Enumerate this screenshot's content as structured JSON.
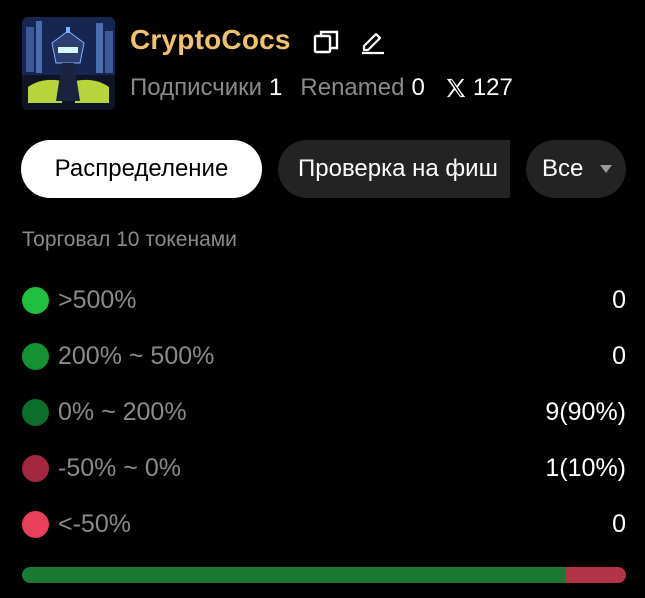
{
  "profile": {
    "name": "CryptoCocs",
    "followers_label": "Подписчики",
    "followers_value": "1",
    "renamed_label": "Renamed",
    "renamed_value": "0",
    "x_followers": "127"
  },
  "tabs": [
    {
      "label": "Распределение",
      "active": true
    },
    {
      "label": "Проверка на фиш",
      "active": false
    }
  ],
  "filter": {
    "selected": "Все"
  },
  "traded_text": "Торговал 10 токенами",
  "distribution": [
    {
      "label": ">500%",
      "value": "0",
      "color": "#1fbf3f"
    },
    {
      "label": "200% ~ 500%",
      "value": "0",
      "color": "#159334"
    },
    {
      "label": "0% ~ 200%",
      "value": "9(90%)",
      "color": "#0b6e2a"
    },
    {
      "label": "-50% ~ 0%",
      "value": "1(10%)",
      "color": "#a3283f"
    },
    {
      "label": "<-50%",
      "value": "0",
      "color": "#e8405a"
    }
  ],
  "bar": [
    {
      "fraction": 0.9,
      "color": "#1a7a34"
    },
    {
      "fraction": 0.1,
      "color": "#b23446"
    }
  ],
  "icons": {
    "avatar": "avatar-image",
    "copy": "copy-icon",
    "edit": "edit-icon",
    "x": "x-logo-icon",
    "caret": "caret-down-icon"
  }
}
